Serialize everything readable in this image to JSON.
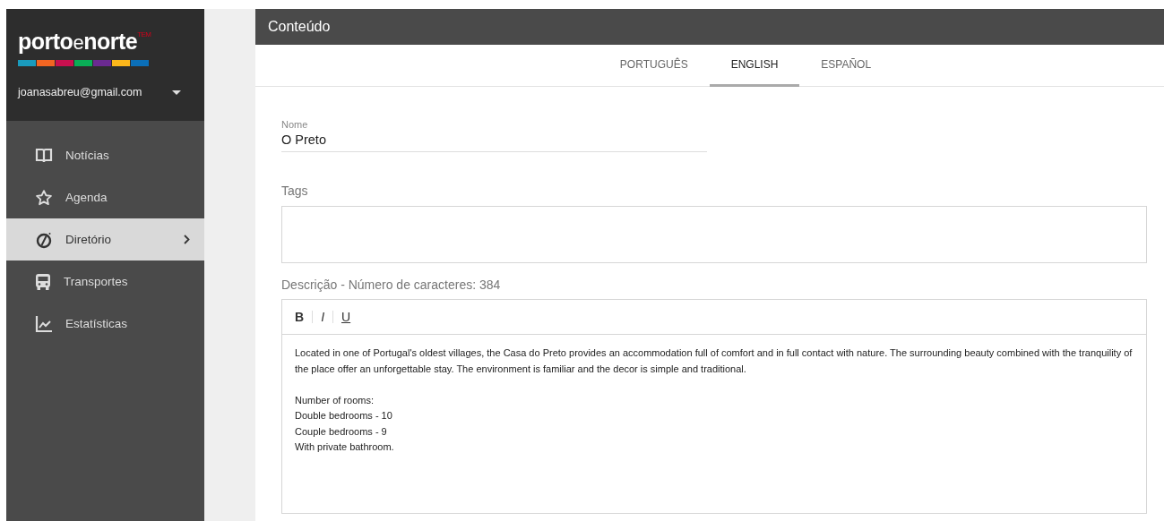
{
  "logo": {
    "part_1": "porto",
    "part_2": "e",
    "part_3": "norte",
    "mark": "TEM"
  },
  "account": {
    "email": "joanasabreu@gmail.com"
  },
  "sidebar": {
    "items": [
      {
        "kind": "book",
        "label": "Notícias",
        "selected": false,
        "has_arrow": false
      },
      {
        "kind": "star",
        "label": "Agenda",
        "selected": false,
        "has_arrow": false
      },
      {
        "kind": "compass",
        "label": "Diretório",
        "selected": true,
        "has_arrow": true
      },
      {
        "kind": "bus",
        "label": "Transportes",
        "selected": false,
        "has_arrow": false
      },
      {
        "kind": "chart",
        "label": "Estatísticas",
        "selected": false,
        "has_arrow": false
      }
    ]
  },
  "header": {
    "title": "Conteúdo"
  },
  "tabs": [
    {
      "label": "PORTUGUÊS",
      "selected": false
    },
    {
      "label": "ENGLISH",
      "selected": true
    },
    {
      "label": "ESPAÑOL",
      "selected": false
    }
  ],
  "name_field": {
    "label": "Nome",
    "value": "O Preto"
  },
  "tags_field": {
    "label": "Tags"
  },
  "description": {
    "label": "Descrição - Número de caracteres: 384",
    "toolbar": [
      {
        "kind": "bold",
        "label": "B"
      },
      {
        "kind": "italic",
        "label": "I"
      },
      {
        "kind": "underline",
        "label": "U"
      }
    ],
    "blocks": [
      {
        "lines": [
          "Located in one of Portugal's oldest villages, the Casa do Preto provides an accommodation full of comfort and in full contact with nature. The surrounding beauty combined with the tranquility of the place offer an unforgettable stay. The environment is familiar and the decor is simple and traditional."
        ]
      },
      {
        "lines": [
          "Number of rooms:",
          "Double bedrooms - 10",
          "Couple bedrooms - 9",
          "With private bathroom."
        ]
      }
    ]
  }
}
